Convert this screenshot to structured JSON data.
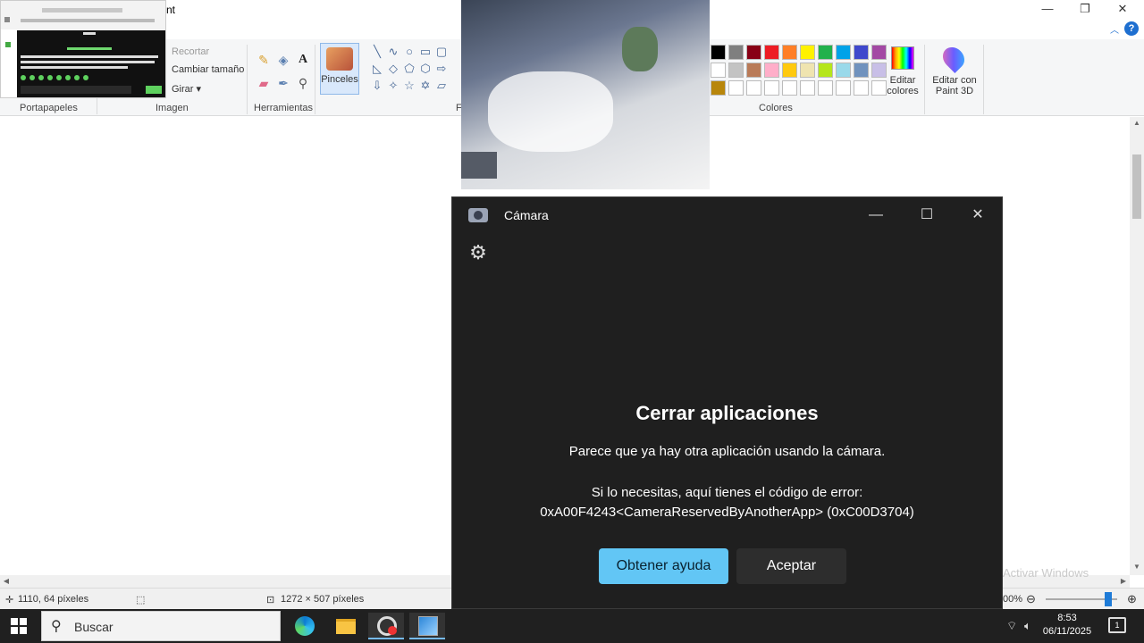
{
  "paint": {
    "title_suffix": "nt",
    "groups": {
      "clipboard": "Portapapeles",
      "image": "Imagen",
      "tools": "Herramientas",
      "shapes": "F",
      "colors": "Colores"
    },
    "image_commands": [
      "Recortar",
      "Cambiar tamaño",
      "Girar"
    ],
    "brushes_label": "Pinceles",
    "edit_colors_label": "Editar colores",
    "paint3d_label": "Editar con Paint 3D",
    "palette": {
      "row1": [
        "#000000",
        "#7f7f7f",
        "#880015",
        "#ed1c24",
        "#ff7f27",
        "#fff200",
        "#22b14c",
        "#00a2e8",
        "#3f48cc",
        "#a349a4"
      ],
      "row2": [
        "#ffffff",
        "#c3c3c3",
        "#b97a57",
        "#ffaec9",
        "#ffc90e",
        "#efe4b0",
        "#b5e61d",
        "#99d9ea",
        "#7092be",
        "#c8bfe7"
      ],
      "row3": [
        "#b8860b",
        "#ffffff",
        "#ffffff",
        "#ffffff",
        "#ffffff",
        "#ffffff",
        "#ffffff",
        "#ffffff",
        "#ffffff",
        "#ffffff"
      ]
    },
    "status": {
      "cursor_pos": "1110, 64 píxeles",
      "canvas_size": "1272 × 507 píxeles",
      "zoom": "00%"
    },
    "watermark": "Activar Windows"
  },
  "camera_app": {
    "title": "Cámara",
    "heading": "Cerrar aplicaciones",
    "message": "Parece que ya hay otra aplicación usando la cámara.",
    "error_intro": "Si lo necesitas, aquí tienes el código de error:",
    "error_code": "0xA00F4243<CameraReservedByAnotherApp> (0xC00D3704)",
    "help_button": "Obtener ayuda",
    "ok_button": "Aceptar"
  },
  "taskbar": {
    "search_placeholder": "Buscar",
    "time": "8:53",
    "date": "06/11/2025",
    "notifications": "1"
  }
}
